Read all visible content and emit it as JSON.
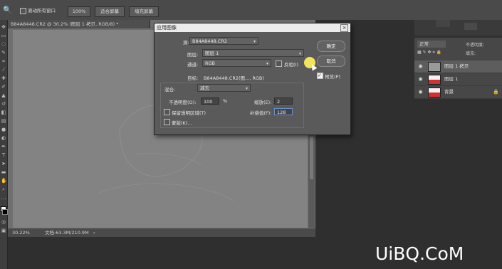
{
  "options_bar": {
    "scroll_all_windows": "滚动所有窗口",
    "zoom_100": "100%",
    "fit_screen": "适合屏幕",
    "fill_screen": "填充屏幕"
  },
  "document": {
    "tab_title": "B84A8448.CR2 @ 30.2% (图层 1 拷贝, RGB/8) *",
    "status_zoom": "30.22%",
    "status_doc": "文档:63.3M/210.9M"
  },
  "layers": {
    "blend_mode": "正常",
    "opacity_label": "不透明度:",
    "fill_label": "填充:",
    "items": [
      {
        "name": "图层 1 拷贝"
      },
      {
        "name": "图层 1"
      },
      {
        "name": "背景"
      }
    ]
  },
  "dialog": {
    "title": "应用图像",
    "source_label": "源:",
    "source_value": "B84A8448.CR2",
    "layer_label": "图层:",
    "layer_value": "图层 1",
    "channel_label": "通道:",
    "channel_value": "RGB",
    "invert_label": "反相(I)",
    "target_label": "目标:",
    "target_value": "B84A8448.CR2(图..., RGB)",
    "blending_label": "混合:",
    "blending_value": "减去",
    "opacity_label": "不透明度(O):",
    "opacity_value": "100",
    "opacity_unit": "%",
    "scale_label": "缩放(E):",
    "scale_value": "2",
    "preserve_label": "保留透明区域(T)",
    "offset_label": "补偿值(F):",
    "offset_value": "128",
    "mask_label": "蒙版(K)...",
    "ok_label": "确定",
    "cancel_label": "取消",
    "preview_label": "预览(P)",
    "preview_checked": true
  },
  "watermark": "UiBQ.CoM"
}
